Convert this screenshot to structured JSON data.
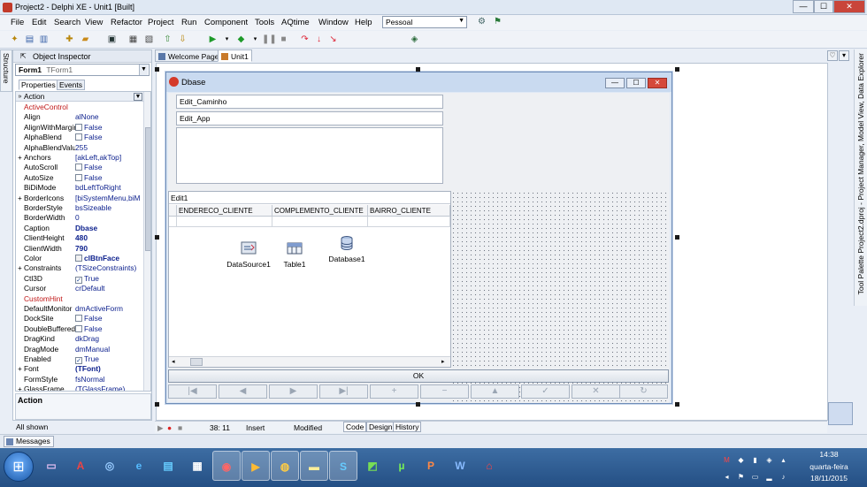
{
  "window": {
    "title": "Project2 - Delphi XE - Unit1 [Built]",
    "btn_min": "—",
    "btn_max": "☐",
    "btn_close": "✕"
  },
  "menu": [
    "File",
    "Edit",
    "Search",
    "View",
    "Refactor",
    "Project",
    "Run",
    "Component",
    "Tools",
    "AQtime",
    "Window",
    "Help"
  ],
  "desktop_layout": "Pessoal",
  "structure_tab": "Structure",
  "object_inspector": {
    "title": "Object Inspector",
    "object": "Form1",
    "object_class": "TForm1",
    "tabs": [
      "Properties",
      "Events"
    ],
    "header_prop": "Action",
    "properties": [
      {
        "name": "ActiveControl",
        "value": "",
        "red": true
      },
      {
        "name": "Align",
        "value": "alNone"
      },
      {
        "name": "AlignWithMargins",
        "value": "False",
        "check": true,
        "checked": false
      },
      {
        "name": "AlphaBlend",
        "value": "False",
        "check": true,
        "checked": false
      },
      {
        "name": "AlphaBlendValue",
        "value": "255"
      },
      {
        "name": "Anchors",
        "value": "[akLeft,akTop]",
        "expand": "+"
      },
      {
        "name": "AutoScroll",
        "value": "False",
        "check": true,
        "checked": false
      },
      {
        "name": "AutoSize",
        "value": "False",
        "check": true,
        "checked": false
      },
      {
        "name": "BiDiMode",
        "value": "bdLeftToRight"
      },
      {
        "name": "BorderIcons",
        "value": "[biSystemMenu,biMini",
        "expand": "+"
      },
      {
        "name": "BorderStyle",
        "value": "bsSizeable"
      },
      {
        "name": "BorderWidth",
        "value": "0"
      },
      {
        "name": "Caption",
        "value": "Dbase",
        "bold": true
      },
      {
        "name": "ClientHeight",
        "value": "480",
        "bold": true
      },
      {
        "name": "ClientWidth",
        "value": "790",
        "bold": true
      },
      {
        "name": "Color",
        "value": "clBtnFace",
        "bold": true,
        "swatch": true
      },
      {
        "name": "Constraints",
        "value": "(TSizeConstraints)",
        "expand": "+"
      },
      {
        "name": "Ctl3D",
        "value": "True",
        "check": true,
        "checked": true
      },
      {
        "name": "Cursor",
        "value": "crDefault"
      },
      {
        "name": "CustomHint",
        "value": "",
        "red": true
      },
      {
        "name": "DefaultMonitor",
        "value": "dmActiveForm"
      },
      {
        "name": "DockSite",
        "value": "False",
        "check": true,
        "checked": false
      },
      {
        "name": "DoubleBuffered",
        "value": "False",
        "check": true,
        "checked": false
      },
      {
        "name": "DragKind",
        "value": "dkDrag"
      },
      {
        "name": "DragMode",
        "value": "dmManual"
      },
      {
        "name": "Enabled",
        "value": "True",
        "check": true,
        "checked": true
      },
      {
        "name": "Font",
        "value": "(TFont)",
        "expand": "+",
        "bold": true
      },
      {
        "name": "FormStyle",
        "value": "fsNormal"
      },
      {
        "name": "GlassFrame",
        "value": "(TGlassFrame)",
        "expand": "+"
      }
    ],
    "description_title": "Action",
    "status": "All shown"
  },
  "doc_tabs": [
    "Welcome Page",
    "Unit1"
  ],
  "form": {
    "caption": "Dbase",
    "edit_caminho": "Edit_Caminho",
    "edit_app": "Edit_App",
    "memo": "",
    "grid_edit": "Edit1",
    "grid_columns": [
      "ENDERECO_CLIENTE",
      "COMPLEMENTO_CLIENTE",
      "BAIRRO_CLIENTE"
    ],
    "components": [
      "DataSource1",
      "Table1",
      "Database1"
    ],
    "ok_button": "OK",
    "nav_glyphs": [
      "|◀",
      "◀",
      "▶",
      "▶|",
      "+",
      "−",
      "▲",
      "✓",
      "✕",
      "↻"
    ]
  },
  "editor_status": {
    "position": "38:  11",
    "mode": "Insert",
    "state": "Modified",
    "bottom_tabs": [
      "Code",
      "Design",
      "History"
    ]
  },
  "messages_label": "Messages",
  "right_strip": "Tool Palette  Project2.dproj - Project Manager, Model View, Data Explorer",
  "taskbar": {
    "time": "14:38",
    "day": "quarta-feira",
    "date": "18/11/2015"
  }
}
